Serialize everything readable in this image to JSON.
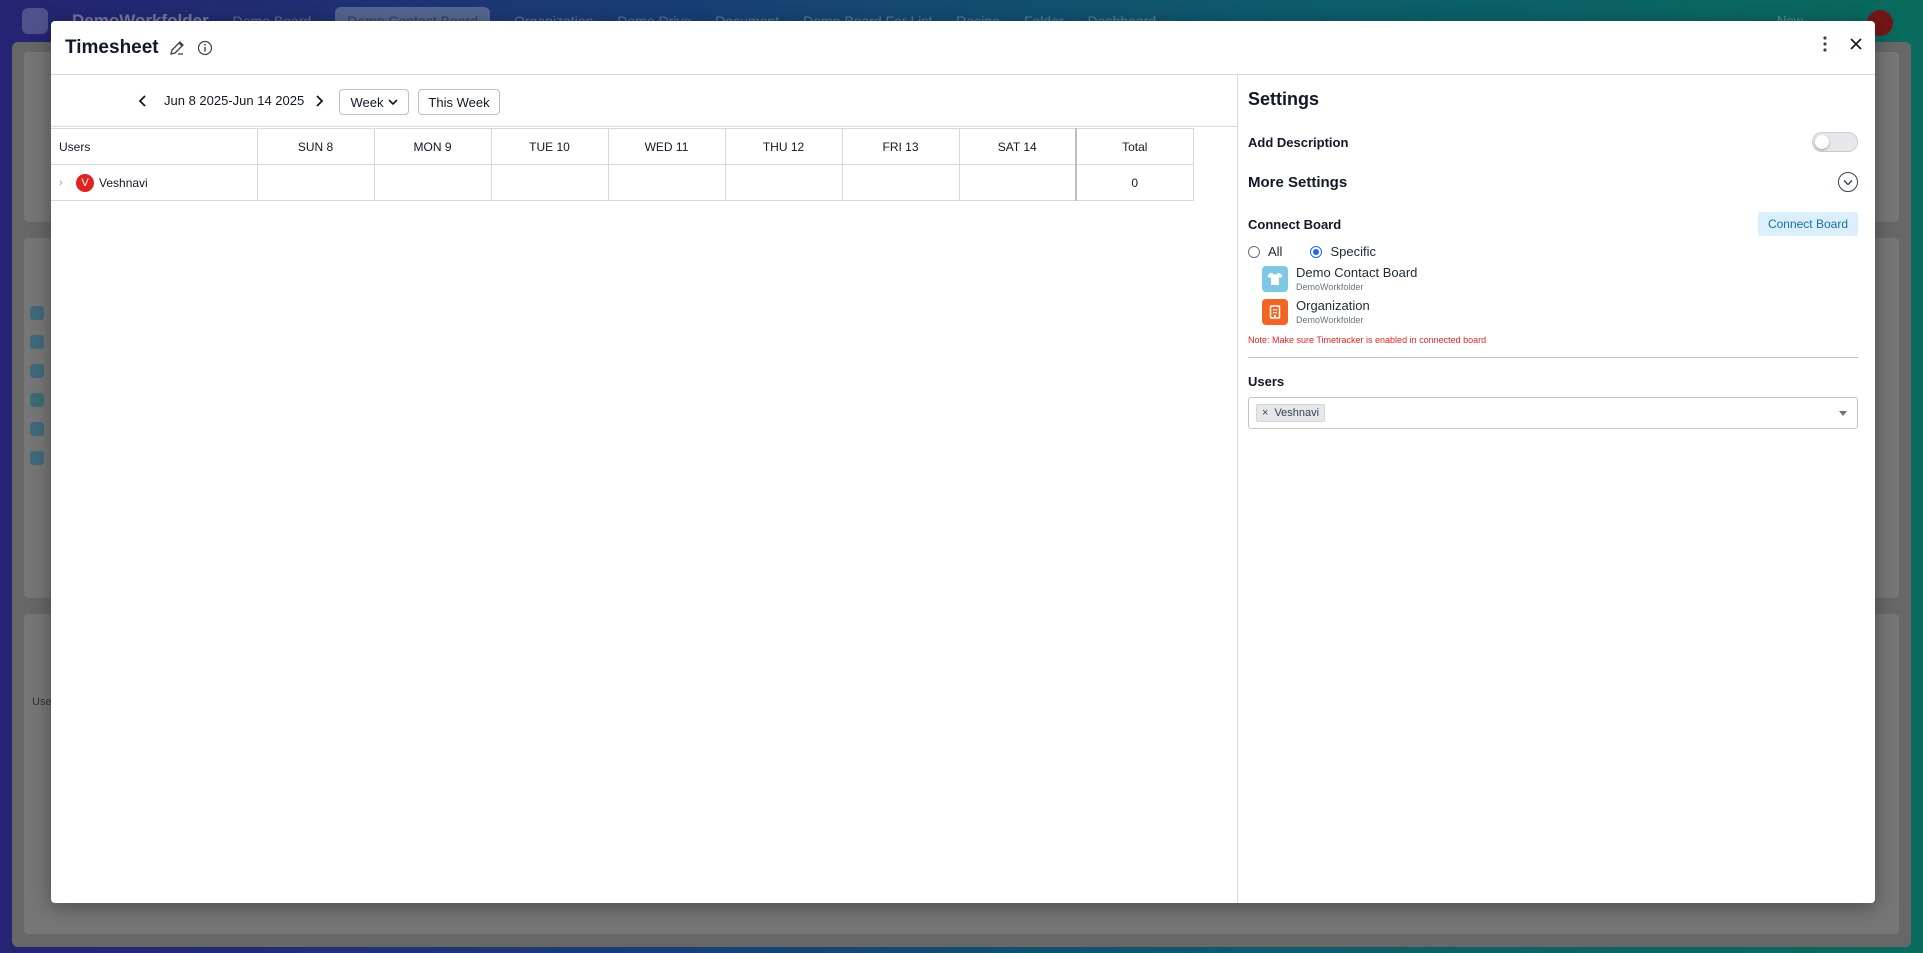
{
  "background": {
    "brand": "DemoWorkfolder",
    "tabs": [
      "Demo Board",
      "Demo Contact Board",
      "Organization",
      "Demo Drive",
      "Document",
      "Demo Board For List",
      "Recipe",
      "Folder",
      "Dashboard"
    ],
    "active_tab": "Demo Contact Board",
    "new_label": "New",
    "avatar_letter": "V",
    "users_label": "Use"
  },
  "modal": {
    "title": "Timesheet",
    "icons": {
      "edit": "edit-icon",
      "info": "info-icon",
      "more": "more-vertical-icon",
      "close": "close-icon"
    }
  },
  "toolbar": {
    "date_range": "Jun 8 2025-Jun 14 2025",
    "view_select": "Week",
    "this_week_label": "This Week"
  },
  "table": {
    "columns": [
      "Users",
      "SUN 8",
      "MON 9",
      "TUE 10",
      "WED 11",
      "THU 12",
      "FRI 13",
      "SAT 14",
      "Total"
    ],
    "rows": [
      {
        "user": "Veshnavi",
        "avatar_letter": "V",
        "days": [
          "",
          "",
          "",
          "",
          "",
          "",
          ""
        ],
        "total": "0"
      }
    ]
  },
  "settings": {
    "title": "Settings",
    "add_description_label": "Add Description",
    "add_description_on": false,
    "more_settings_label": "More Settings",
    "connect_board_label": "Connect Board",
    "connect_board_button": "Connect Board",
    "scope_options": [
      "All",
      "Specific"
    ],
    "scope_selected": "Specific",
    "boards": [
      {
        "name": "Demo Contact Board",
        "folder": "DemoWorkfolder",
        "icon": "shirt-icon",
        "color": "#7ec8e3"
      },
      {
        "name": "Organization",
        "folder": "DemoWorkfolder",
        "icon": "building-icon",
        "color": "#f26522"
      }
    ],
    "note": "Note: Make sure Timetracker is enabled in connected board",
    "users_label": "Users",
    "selected_users": [
      "Veshnavi"
    ]
  },
  "colors": {
    "accent": "#2563eb",
    "avatar": "#e02424",
    "connect_button_bg": "#dbeefb",
    "note": "#e02424"
  }
}
